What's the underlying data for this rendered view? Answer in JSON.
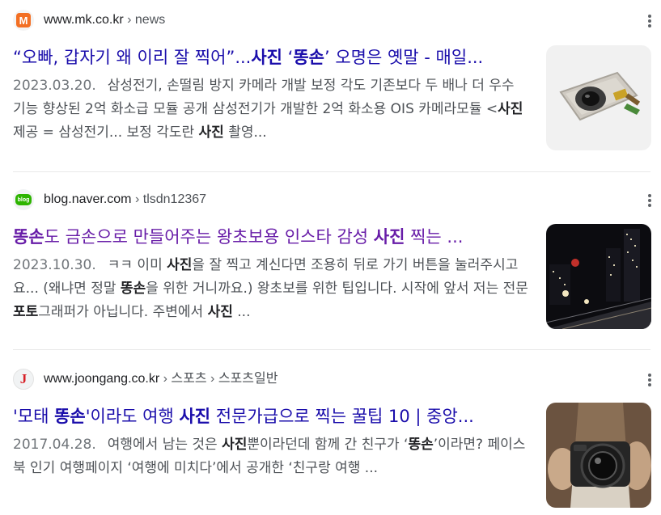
{
  "results": [
    {
      "site_domain": "www.mk.co.kr",
      "site_separator": "›",
      "site_path": "news",
      "favicon_letter": "M",
      "title_parts": [
        "“오빠, 갑자기 왜 이리 잘 찍어”...",
        "사진",
        " ‘",
        "똥손",
        "’ 오명은 옛말 - 매일..."
      ],
      "date": "2023.03.20.",
      "snippet_parts": [
        "삼성전기, 손떨림 방지 카메라 개발 보정 각도 기존보다 두 배나 더 우수 기능 향상된 2억 화소급 모듈 공개 삼성전기가 개발한 2억 화소용 OIS 카메라모듈 <",
        "사진",
        "제공 = 삼성전기... 보정 각도란 ",
        "사진",
        " 촬영..."
      ]
    },
    {
      "site_domain": "blog.naver.com",
      "site_separator": "›",
      "site_path": "tlsdn12367",
      "favicon_text": "blog",
      "title_parts": [
        "똥손",
        "도 금손으로 만들어주는 왕초보용 인스타 감성 ",
        "사진",
        " 찍는 ..."
      ],
      "date": "2023.10.30.",
      "snippet_parts": [
        "ㅋㅋ 이미 ",
        "사진",
        "을 잘 찍고 계신다면 조용히 뒤로 가기 버튼을 눌러주시고요... (왜냐면 정말 ",
        "똥손",
        "을 위한 거니까요.) 왕초보를 위한 팁입니다. 시작에 앞서 저는 전문 ",
        "포토",
        "그래퍼가 아닙니다. 주변에서 ",
        "사진",
        " ..."
      ]
    },
    {
      "site_domain": "www.joongang.co.kr",
      "site_separator": "›",
      "site_path": "스포츠",
      "site_path2": "스포츠일반",
      "favicon_letter": "J",
      "title_parts": [
        "'모태 ",
        "똥손",
        "'이라도 여행 ",
        "사진",
        " 전문가급으로 찍는 꿀팁 10 | 중앙..."
      ],
      "date": "2017.04.28.",
      "snippet_parts": [
        "여행에서 남는 것은 ",
        "사진",
        "뿐이라던데 함께 간 친구가 ‘",
        "똥손",
        "’이라면? 페이스북 인기 여행페이지 ‘여행에 미치다’에서 공개한 ‘친구랑 여행 ..."
      ]
    }
  ],
  "colors": {
    "link": "#1a0dab",
    "visited": "#681da8",
    "snippet": "#4d5156",
    "mk_orange": "#f36f23",
    "naver_green": "#2db400",
    "joongang_red": "#d71f26"
  },
  "icons": [
    "mk-favicon",
    "naver-blog-favicon",
    "joongang-favicon",
    "more-options-icon"
  ]
}
